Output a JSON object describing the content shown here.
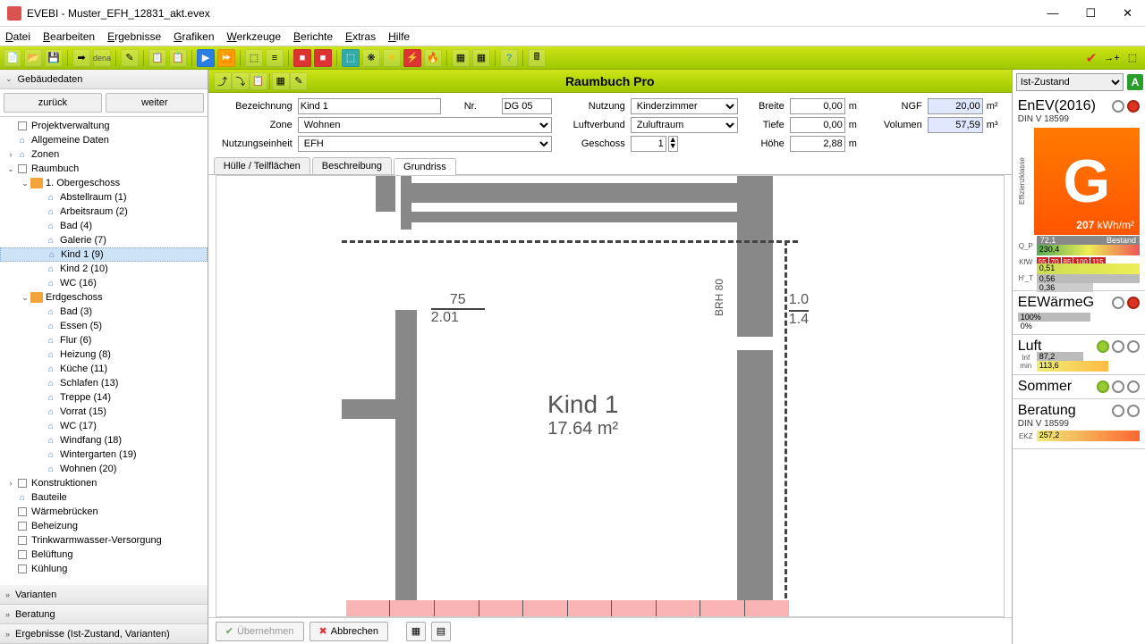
{
  "title": "EVEBI - Muster_EFH_12831_akt.evex",
  "menu": [
    "Datei",
    "Bearbeiten",
    "Ergebnisse",
    "Grafiken",
    "Werkzeuge",
    "Berichte",
    "Extras",
    "Hilfe"
  ],
  "sidebar": {
    "header": "Gebäudedaten",
    "nav_back": "zurück",
    "nav_fwd": "weiter",
    "bottom": [
      "Varianten",
      "Beratung",
      "Ergebnisse (Ist-Zustand, Varianten)"
    ],
    "tree": [
      {
        "d": 0,
        "exp": "",
        "ico": "sq",
        "label": "Projektverwaltung"
      },
      {
        "d": 0,
        "exp": "",
        "ico": "house",
        "label": "Allgemeine Daten"
      },
      {
        "d": 0,
        "exp": "›",
        "ico": "house",
        "label": "Zonen"
      },
      {
        "d": 0,
        "exp": "v",
        "ico": "sq",
        "label": "Raumbuch"
      },
      {
        "d": 1,
        "exp": "v",
        "ico": "folder",
        "label": "1. Obergeschoss"
      },
      {
        "d": 2,
        "exp": "",
        "ico": "house",
        "label": "Abstellraum (1)"
      },
      {
        "d": 2,
        "exp": "",
        "ico": "house",
        "label": "Arbeitsraum (2)"
      },
      {
        "d": 2,
        "exp": "",
        "ico": "house",
        "label": "Bad (4)"
      },
      {
        "d": 2,
        "exp": "",
        "ico": "house",
        "label": "Galerie (7)"
      },
      {
        "d": 2,
        "exp": "",
        "ico": "house",
        "label": "Kind 1 (9)",
        "sel": true
      },
      {
        "d": 2,
        "exp": "",
        "ico": "house",
        "label": "Kind 2 (10)"
      },
      {
        "d": 2,
        "exp": "",
        "ico": "house",
        "label": "WC (16)"
      },
      {
        "d": 1,
        "exp": "v",
        "ico": "folder",
        "label": "Erdgeschoss"
      },
      {
        "d": 2,
        "exp": "",
        "ico": "house",
        "label": "Bad (3)"
      },
      {
        "d": 2,
        "exp": "",
        "ico": "house",
        "label": "Essen (5)"
      },
      {
        "d": 2,
        "exp": "",
        "ico": "house",
        "label": "Flur (6)"
      },
      {
        "d": 2,
        "exp": "",
        "ico": "house",
        "label": "Heizung (8)"
      },
      {
        "d": 2,
        "exp": "",
        "ico": "house",
        "label": "Küche (11)"
      },
      {
        "d": 2,
        "exp": "",
        "ico": "house",
        "label": "Schlafen (13)"
      },
      {
        "d": 2,
        "exp": "",
        "ico": "house",
        "label": "Treppe (14)"
      },
      {
        "d": 2,
        "exp": "",
        "ico": "house",
        "label": "Vorrat (15)"
      },
      {
        "d": 2,
        "exp": "",
        "ico": "house",
        "label": "WC (17)"
      },
      {
        "d": 2,
        "exp": "",
        "ico": "house",
        "label": "Windfang (18)"
      },
      {
        "d": 2,
        "exp": "",
        "ico": "house",
        "label": "Wintergarten (19)"
      },
      {
        "d": 2,
        "exp": "",
        "ico": "house",
        "label": "Wohnen (20)"
      },
      {
        "d": 0,
        "exp": "›",
        "ico": "sq",
        "label": "Konstruktionen"
      },
      {
        "d": 0,
        "exp": "",
        "ico": "house",
        "label": "Bauteile"
      },
      {
        "d": 0,
        "exp": "",
        "ico": "sq",
        "label": "Wärmebrücken"
      },
      {
        "d": 0,
        "exp": "",
        "ico": "sq",
        "label": "Beheizung"
      },
      {
        "d": 0,
        "exp": "",
        "ico": "sq",
        "label": "Trinkwarmwasser-Versorgung"
      },
      {
        "d": 0,
        "exp": "",
        "ico": "sq",
        "label": "Belüftung"
      },
      {
        "d": 0,
        "exp": "",
        "ico": "sq",
        "label": "Kühlung"
      }
    ]
  },
  "center": {
    "title": "Raumbuch Pro",
    "labels": {
      "bez": "Bezeichnung",
      "nr": "Nr.",
      "nutz": "Nutzung",
      "breite": "Breite",
      "ngf": "NGF",
      "zone": "Zone",
      "luft": "Luftverbund",
      "tiefe": "Tiefe",
      "vol": "Volumen",
      "nutzeinh": "Nutzungseinheit",
      "gesch": "Geschoss",
      "hoehe": "Höhe"
    },
    "vals": {
      "bez": "Kind 1",
      "nr": "DG 05",
      "nutz": "Kinderzimmer",
      "breite": "0,00",
      "ngf": "20,00",
      "zone": "Wohnen",
      "luft": "Zuluftraum",
      "tiefe": "0,00",
      "vol": "57,59",
      "nutzeinh": "EFH",
      "gesch": "1",
      "hoehe": "2,88"
    },
    "tabs": [
      "Hülle / Teilflächen",
      "Beschreibung",
      "Grundriss"
    ],
    "active_tab": 2,
    "plan": {
      "room": "Kind 1",
      "area": "17.64 m²",
      "dim_top": "75",
      "dim_top2": "2.01",
      "brh": "BRH 80",
      "dim_r1": "1.0",
      "dim_r2": "1.4"
    },
    "btn_ok": "Übernehmen",
    "btn_cancel": "Abbrechen"
  },
  "rpanel": {
    "selector": "Ist-Zustand",
    "enev": {
      "title": "EnEV(2016)",
      "sub": "DIN V 18599",
      "letter": "G",
      "val": "207",
      "unit": "kWh/m²",
      "eff": "Effizienzklasse"
    },
    "qp": {
      "label": "Q_P",
      "v1": "72,1",
      "v2": "230,4",
      "txt": "Bestand"
    },
    "kfw": {
      "label": "KfW",
      "vals": [
        "55",
        "70",
        "85",
        "100",
        "115"
      ]
    },
    "ht": {
      "label": "H'_T",
      "v1": "0,51",
      "v2": "0,56",
      "v3": "0,36"
    },
    "eewg": {
      "title": "EEWärmeG",
      "v1": "100%",
      "v2": "0%"
    },
    "luft": {
      "title": "Luft",
      "label": "Inf min",
      "v1": "87,2",
      "v2": "113,6"
    },
    "sommer": {
      "title": "Sommer"
    },
    "beratung": {
      "title": "Beratung",
      "sub": "DIN V 18599",
      "label": "EKZ",
      "v": "257,2"
    }
  }
}
